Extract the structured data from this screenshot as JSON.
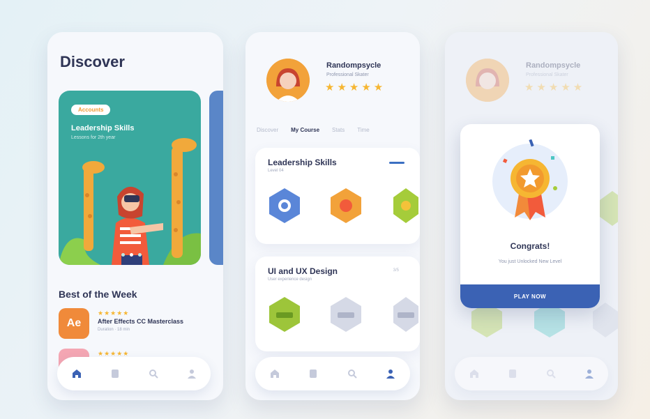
{
  "discover": {
    "title": "Discover",
    "hero": {
      "pill": "Accounts",
      "title": "Leadership Skills",
      "subtitle": "Lessons for 2th year"
    },
    "section_title": "Best of the Week",
    "courses": [
      {
        "icon_text": "Ae",
        "stars": "★★★★★",
        "name": "After Effects CC Masterclass",
        "meta": "Duration · 18 min",
        "color": "#f08a3a"
      },
      {
        "icon_text": "",
        "stars": "★★★★★",
        "name": "",
        "meta": "",
        "color": "#f4a6b3"
      }
    ],
    "nav": [
      "home-icon",
      "book-icon",
      "search-icon",
      "user-icon"
    ]
  },
  "profile": {
    "name": "Randompsycle",
    "role": "Professional Skater",
    "stars": "★★★★★",
    "tabs": [
      "Discover",
      "My Course",
      "Stats",
      "Time"
    ],
    "active_tab": 1,
    "cards": [
      {
        "title": "Leadership Skills",
        "sub": "Level 04",
        "meta": ""
      },
      {
        "title": "UI and UX Design",
        "sub": "User experience design",
        "meta": "3/5"
      }
    ]
  },
  "congrats": {
    "name": "Randompsycle",
    "role": "Professional Skater",
    "stars": "★★★★★",
    "title": "Congrats!",
    "subtitle": "You just Unlocked New Level",
    "button": "PLAY NOW"
  },
  "colors": {
    "accent": "#3b62b4",
    "orange": "#f2a23a",
    "teal": "#3aa99f",
    "star": "#f6b632"
  }
}
